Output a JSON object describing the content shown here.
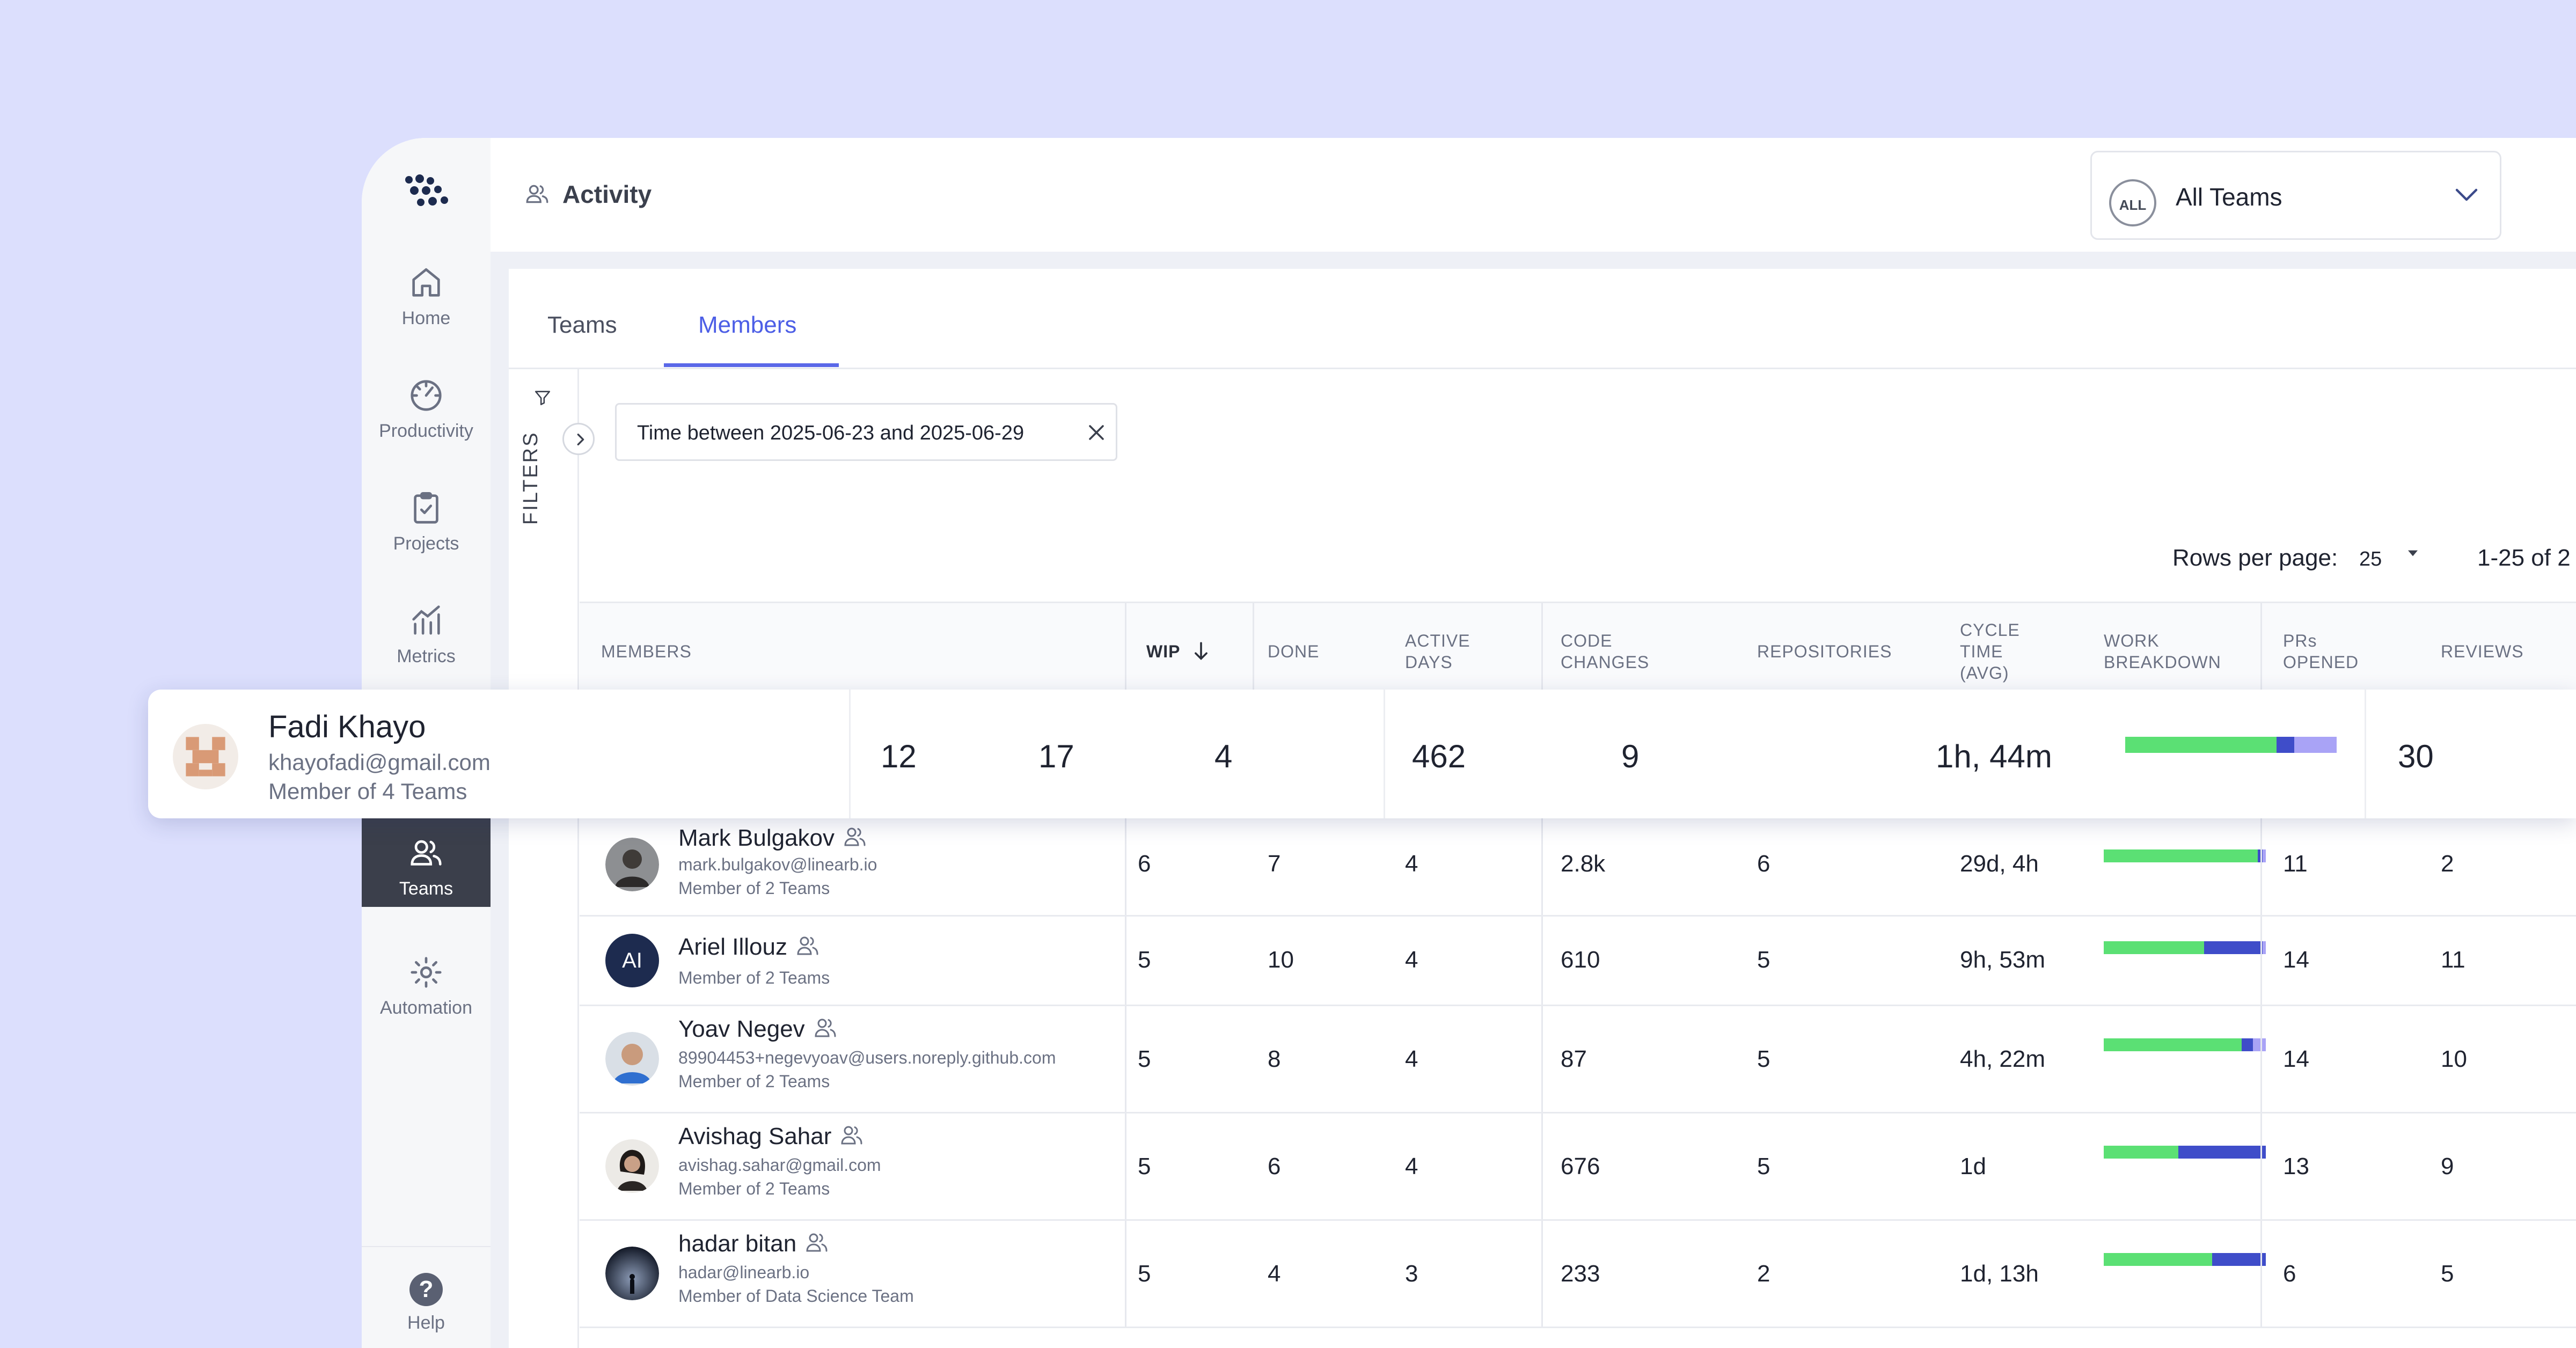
{
  "nav": {
    "items": [
      {
        "key": "home",
        "label": "Home"
      },
      {
        "key": "productivity",
        "label": "Productivity"
      },
      {
        "key": "projects",
        "label": "Projects"
      },
      {
        "key": "metrics",
        "label": "Metrics"
      },
      {
        "key": "teams",
        "label": "Teams"
      },
      {
        "key": "automation",
        "label": "Automation"
      }
    ],
    "active": "Teams",
    "help_label": "Help",
    "help_glyph": "?"
  },
  "header": {
    "title": "Activity",
    "team_selector": {
      "badge": "ALL",
      "value": "All Teams"
    }
  },
  "tabs": [
    {
      "label": "Teams",
      "active": false
    },
    {
      "label": "Members",
      "active": true
    }
  ],
  "filters": {
    "label": "FILTERS",
    "chips": [
      {
        "label": "Time between 2025-06-23 and 2025-06-29"
      }
    ]
  },
  "pagination": {
    "rows_per_page_label": "Rows per page:",
    "rows_per_page": "25",
    "range": "1-25 of 2"
  },
  "table": {
    "columns": {
      "members": "MEMBERS",
      "wip": "WIP",
      "done": "DONE",
      "active_days": [
        "ACTIVE",
        "DAYS"
      ],
      "code_changes": [
        "CODE",
        "CHANGES"
      ],
      "repositories": "REPOSITORIES",
      "cycle_time": [
        "CYCLE",
        "TIME",
        "(AVG)"
      ],
      "work_breakdown": [
        "WORK",
        "BREAKDOWN"
      ],
      "prs_opened": [
        "PRs",
        "OPENED"
      ],
      "reviews": "REVIEWS"
    },
    "highlighted_row": {
      "name": "Fadi Khayo",
      "email": "khayofadi@gmail.com",
      "membership": "Member of 4 Teams",
      "wip": "12",
      "done": "17",
      "active_days": "4",
      "code_changes": "462",
      "repositories": "9",
      "cycle_time": "1h, 44m",
      "work_breakdown": [
        0.715,
        0.085,
        0.2
      ],
      "prs_opened": "30"
    },
    "rows": [
      {
        "name": "Mark Bulgakov",
        "email": "mark.bulgakov@linearb.io",
        "membership": "Member of 2 Teams",
        "wip": "6",
        "done": "7",
        "active_days": "4",
        "code_changes": "2.8k",
        "repositories": "6",
        "cycle_time": "29d, 4h",
        "work_breakdown": [
          0.95,
          0.03,
          0.02
        ],
        "prs_opened": "11",
        "reviews": "2",
        "avatar": "photo"
      },
      {
        "name": "Ariel Illouz",
        "email": "",
        "membership": "Member of 2 Teams",
        "initials": "AI",
        "wip": "5",
        "done": "10",
        "active_days": "4",
        "code_changes": "610",
        "repositories": "5",
        "cycle_time": "9h, 53m",
        "work_breakdown": [
          0.62,
          0.36,
          0.02
        ],
        "prs_opened": "14",
        "reviews": "11",
        "avatar": "initials"
      },
      {
        "name": "Yoav Negev",
        "email": "89904453+negevyoav@users.noreply.github.com",
        "membership": "Member of 2 Teams",
        "wip": "5",
        "done": "8",
        "active_days": "4",
        "code_changes": "87",
        "repositories": "5",
        "cycle_time": "4h, 22m",
        "work_breakdown": [
          0.85,
          0.07,
          0.08
        ],
        "prs_opened": "14",
        "reviews": "10",
        "avatar": "photo"
      },
      {
        "name": "Avishag Sahar",
        "email": "avishag.sahar@gmail.com",
        "membership": "Member of 2 Teams",
        "wip": "5",
        "done": "6",
        "active_days": "4",
        "code_changes": "676",
        "repositories": "5",
        "cycle_time": "1d",
        "work_breakdown": [
          0.46,
          0.54,
          0
        ],
        "prs_opened": "13",
        "reviews": "9",
        "avatar": "photo"
      },
      {
        "name": "hadar bitan",
        "email": "hadar@linearb.io",
        "membership": "Member of Data Science Team",
        "wip": "5",
        "done": "4",
        "active_days": "3",
        "code_changes": "233",
        "repositories": "2",
        "cycle_time": "1d, 13h",
        "work_breakdown": [
          0.67,
          0.33,
          0
        ],
        "prs_opened": "6",
        "reviews": "5",
        "avatar": "photo"
      }
    ]
  },
  "colors": {
    "accent": "#4c5ee6",
    "bar_green": "#5be074",
    "bar_blue": "#3f4dc9",
    "bar_lavender": "#a9a3f6",
    "page_bg": "#dcdffd"
  }
}
